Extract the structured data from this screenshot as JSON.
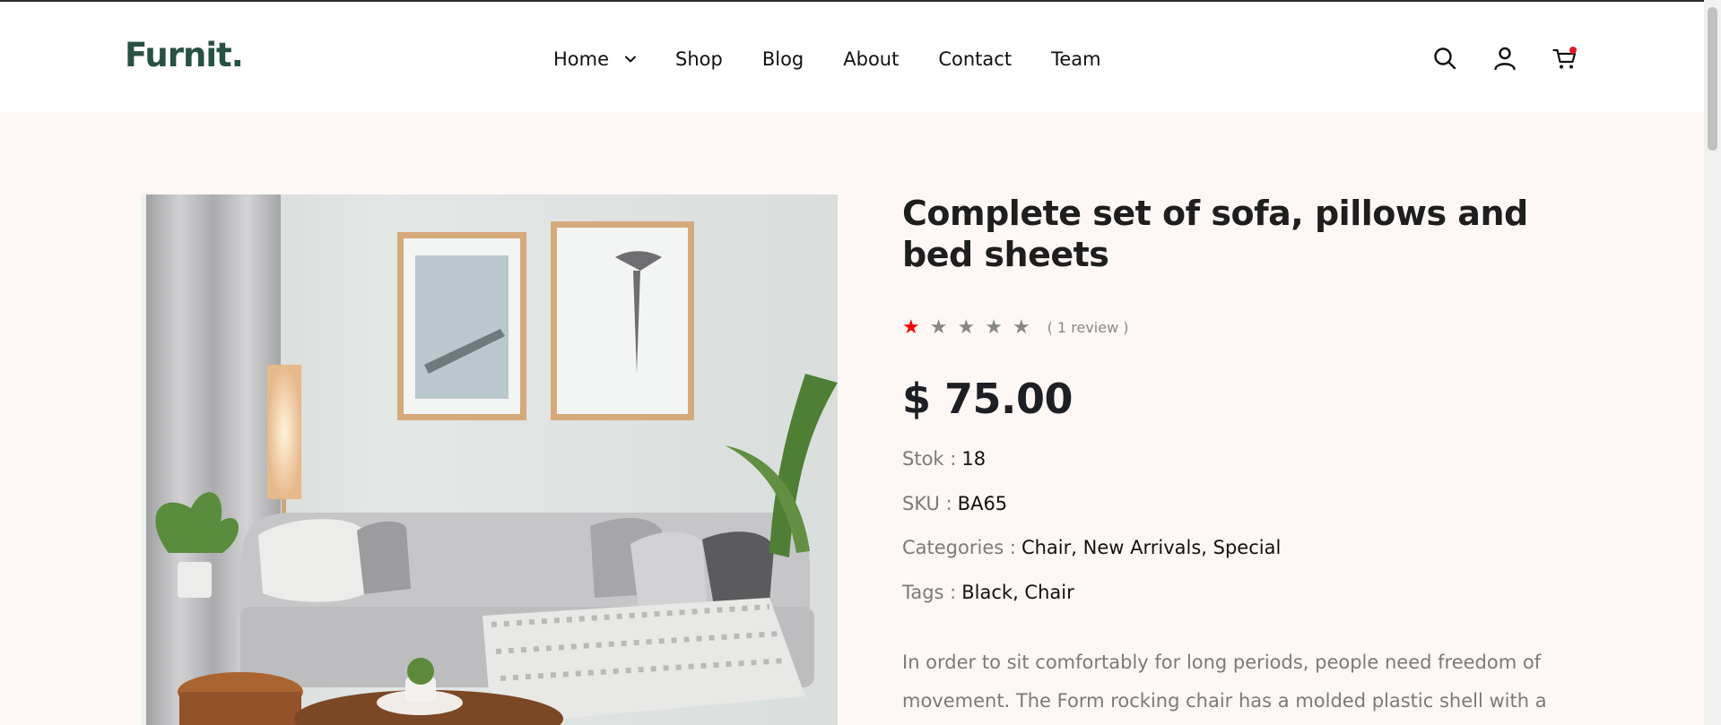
{
  "header": {
    "logo": "Furnit.",
    "nav": [
      {
        "label": "Home",
        "has_dropdown": true
      },
      {
        "label": "Shop"
      },
      {
        "label": "Blog"
      },
      {
        "label": "About"
      },
      {
        "label": "Contact"
      },
      {
        "label": "Team"
      }
    ],
    "icons": [
      "search-icon",
      "user-icon",
      "cart-icon"
    ]
  },
  "product": {
    "title": "Complete set of sofa, pillows and bed sheets",
    "rating": 1,
    "rating_max": 5,
    "review_count": "( 1 review )",
    "price": "$ 75.00",
    "meta": [
      {
        "label": "Stok :",
        "value": "18"
      },
      {
        "label": "SKU :",
        "value": "BA65"
      },
      {
        "label": "Categories :",
        "value": "Chair, New Arrivals, Special"
      },
      {
        "label": "Tags :",
        "value": "Black, Chair"
      }
    ],
    "description": "In order to sit comfortably for long periods, people need freedom of movement. The Form rocking chair has a molded plastic shell with a wide,"
  },
  "colors": {
    "brand": "#285143",
    "star_filled": "#ff0000",
    "star_empty": "#888888",
    "cart_badge": "#e11d2a",
    "page_bg": "#fdf8f5"
  }
}
